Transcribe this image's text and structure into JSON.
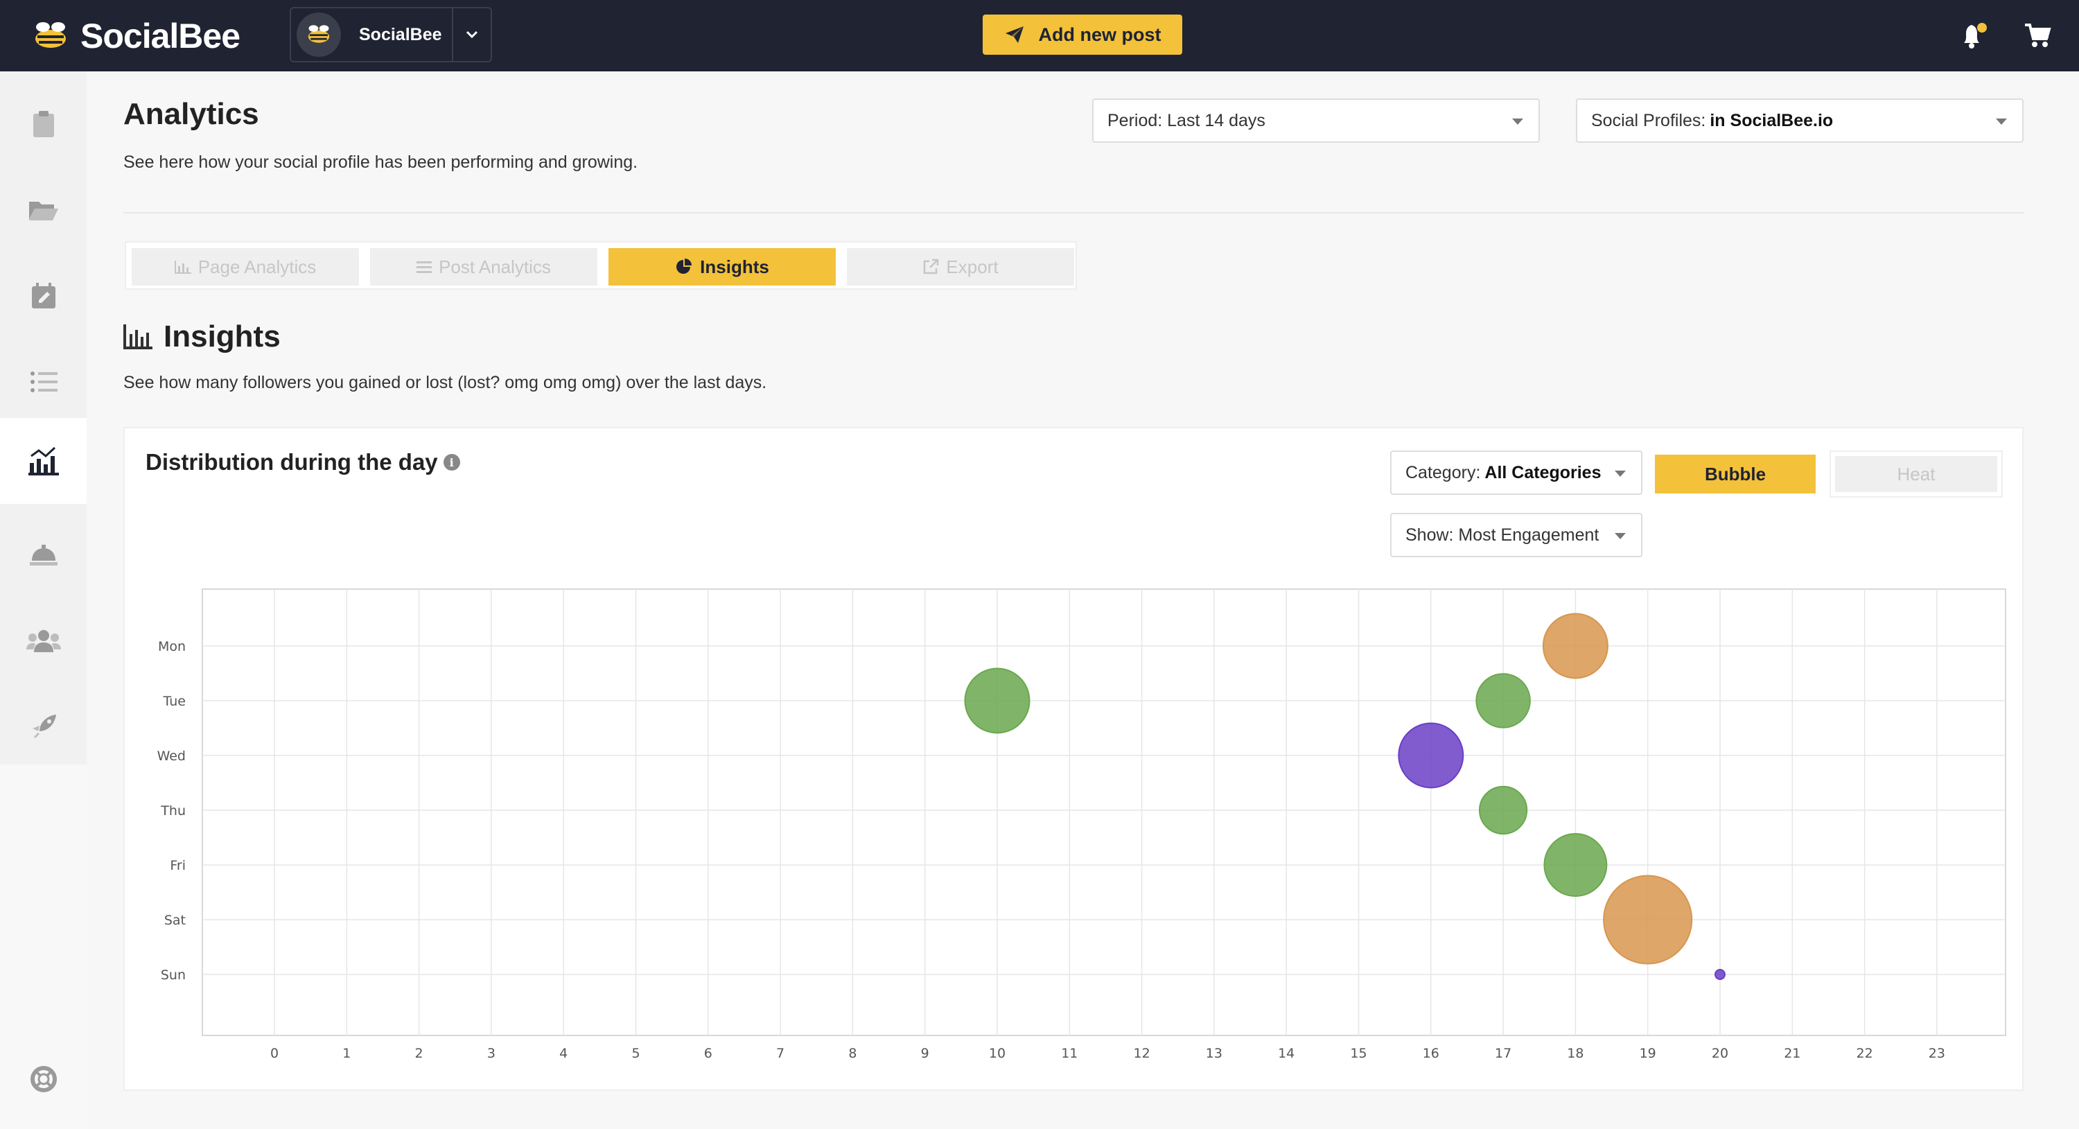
{
  "app": {
    "name": "SocialBee"
  },
  "topbar": {
    "brand_switch_name": "SocialBee",
    "add_post_label": "Add new post"
  },
  "header": {
    "title": "Analytics",
    "subtitle": "See here how your social profile has been performing and growing.",
    "period_label": "Period: Last 14 days",
    "profiles_prefix": "Social Profiles:",
    "profiles_value": "in SocialBee.io"
  },
  "tabs": [
    {
      "label": "Page Analytics",
      "icon": "bar-chart-icon"
    },
    {
      "label": "Post Analytics",
      "icon": "list-icon"
    },
    {
      "label": "Insights",
      "icon": "pie-chart-icon",
      "active": true
    },
    {
      "label": "Export",
      "icon": "external-link-icon"
    }
  ],
  "insights": {
    "title": "Insights",
    "subtitle": "See how many followers you gained or lost (lost? omg omg omg) over the last days."
  },
  "card": {
    "title": "Distribution during the day",
    "category_prefix": "Category:",
    "category_value": "All Categories",
    "show_label": "Show: Most Engagement",
    "bubble_label": "Bubble",
    "heat_label": "Heat"
  },
  "colors": {
    "accent": "#f3c13a",
    "topbar": "#1f2332",
    "bubble_green": "#6aa84f",
    "bubble_orange": "#d8964f",
    "bubble_purple": "#6a3fc7"
  },
  "chart_data": {
    "type": "scatter",
    "x_ticks": [
      "0",
      "1",
      "2",
      "3",
      "4",
      "5",
      "6",
      "7",
      "8",
      "9",
      "10",
      "11",
      "12",
      "13",
      "14",
      "15",
      "16",
      "17",
      "18",
      "19",
      "20",
      "21",
      "22",
      "23"
    ],
    "y_ticks": [
      "Mon",
      "Tue",
      "Wed",
      "Thu",
      "Fri",
      "Sat",
      "Sun"
    ],
    "grid": true,
    "points": [
      {
        "hour": 10,
        "day": "Tue",
        "size": 3,
        "color": "#6aa84f"
      },
      {
        "hour": 18,
        "day": "Mon",
        "size": 3,
        "color": "#d8964f"
      },
      {
        "hour": 17,
        "day": "Tue",
        "size": 2.5,
        "color": "#6aa84f"
      },
      {
        "hour": 16,
        "day": "Wed",
        "size": 3,
        "color": "#6a3fc7"
      },
      {
        "hour": 17,
        "day": "Thu",
        "size": 2.2,
        "color": "#6aa84f"
      },
      {
        "hour": 18,
        "day": "Fri",
        "size": 2.9,
        "color": "#6aa84f"
      },
      {
        "hour": 19,
        "day": "Sat",
        "size": 4.1,
        "color": "#d8964f"
      },
      {
        "hour": 20,
        "day": "Sun",
        "size": 0.45,
        "color": "#6a3fc7"
      }
    ]
  }
}
